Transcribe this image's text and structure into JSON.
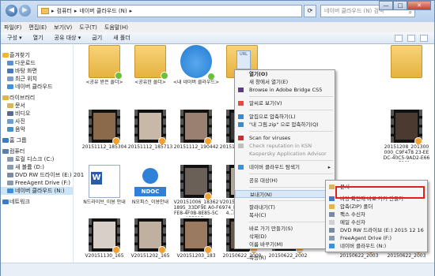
{
  "window": {
    "address_parts": [
      "컴퓨터",
      "네이버 클라우드 (N)"
    ],
    "address_sep": "▸",
    "search_placeholder": "네이버 클라우드 (N) 검색",
    "controls": {
      "min": "—",
      "max": "□",
      "close": "✕"
    }
  },
  "menubar": [
    "파일(F)",
    "편집(E)",
    "보기(V)",
    "도구(T)",
    "도움말(H)"
  ],
  "toolbar": {
    "items": [
      "구성 ▾",
      "열기",
      "공유 대상 ▾",
      "굽기",
      "새 폴더"
    ]
  },
  "sidebar": [
    {
      "label": "즐겨찾기",
      "group": true,
      "icon": "star-icon",
      "color": "#f2b632"
    },
    {
      "label": "다운로드",
      "icon": "download-icon",
      "color": "#5a8fd0"
    },
    {
      "label": "바탕 화면",
      "icon": "desktop-icon",
      "color": "#4a78c0"
    },
    {
      "label": "최근 위치",
      "icon": "recent-icon",
      "color": "#7a9cc6"
    },
    {
      "label": "네이버 클라우드",
      "icon": "cloud-icon",
      "color": "#3d8fe0"
    },
    {
      "label": "라이브러리",
      "group": true,
      "icon": "library-icon",
      "color": "#e2b54a"
    },
    {
      "label": "문서",
      "icon": "document-icon",
      "color": "#d9b45a"
    },
    {
      "label": "비디오",
      "icon": "video-icon",
      "color": "#5a6a8a"
    },
    {
      "label": "사진",
      "icon": "picture-icon",
      "color": "#6aa0d0"
    },
    {
      "label": "음악",
      "icon": "music-icon",
      "color": "#4a90c8"
    },
    {
      "label": "홈 그룹",
      "group": true,
      "icon": "homegroup-icon",
      "color": "#3c7cc6"
    },
    {
      "label": "컴퓨터",
      "group": true,
      "icon": "computer-icon",
      "color": "#5a7fa8"
    },
    {
      "label": "로컬 디스크 (C:)",
      "icon": "disk-icon",
      "color": "#8a9aae"
    },
    {
      "label": "새 볼륨 (D:)",
      "icon": "disk-icon",
      "color": "#8a9aae"
    },
    {
      "label": "DVD RW 드라이브 (E:) 201",
      "icon": "dvd-icon",
      "color": "#7a8aa0"
    },
    {
      "label": "FreeAgent Drive (F:)",
      "icon": "disk-icon",
      "color": "#8a9aae"
    },
    {
      "label": "네이버 클라우드 (N:)",
      "icon": "cloud-icon",
      "color": "#3d8fe0",
      "selected": true
    },
    {
      "label": "네트워크",
      "group": true,
      "icon": "network-icon",
      "color": "#3c7cc6"
    }
  ],
  "files": [
    {
      "name": "<공유 받은 폴더>",
      "kind": "folder",
      "badge": "green"
    },
    {
      "name": "<공유한 폴더>",
      "kind": "folder",
      "badge": "green"
    },
    {
      "name": "<내 네이버 클라우드>",
      "kind": "cloud"
    },
    {
      "name": "내 그림",
      "kind": "folder-url"
    },
    {
      "name": "",
      "kind": "folder"
    },
    {
      "name": "20151112_185304",
      "kind": "video",
      "color": "#8a6a4a"
    },
    {
      "name": "20151112_185713",
      "kind": "video",
      "color": "#c8b8a8"
    },
    {
      "name": "20151112_190442",
      "kind": "video",
      "color": "#9a8070"
    },
    {
      "name": "20151112_190808",
      "kind": "video",
      "color": "#3a3a3a"
    },
    {
      "name": "20151208_201300000_C9F478 23-EEDC-40C5-9AD2-E66F661...",
      "kind": "video",
      "color": "#4a3a30"
    },
    {
      "name": "N드라이브_이용 안내",
      "kind": "word"
    },
    {
      "name": "N오피스_이용안내",
      "kind": "ndoc"
    },
    {
      "name": "V20151006_183621895_33DF9E A0-FFE8-4F0B-8E85-5CA5781F...",
      "kind": "video",
      "color": "#6a6058"
    },
    {
      "name": "V20151018_144046974_FFC...5-1915-4...E-CF39C...",
      "kind": "video",
      "color": "#b0a898"
    },
    {
      "name": "V20151130_165",
      "kind": "video",
      "color": "#d8d0c8"
    },
    {
      "name": "V20151202_165",
      "kind": "video",
      "color": "#c0b0a0"
    },
    {
      "name": "V20151203_183",
      "kind": "video",
      "color": "#9a7a60"
    },
    {
      "name": "20150622_2000",
      "kind": "video",
      "color": "#6a5a4a"
    },
    {
      "name": "20150622_2002",
      "kind": "video",
      "color": "#5a5048"
    },
    {
      "name": "20150622_2003",
      "kind": "video",
      "color": "#8a7868"
    },
    {
      "name": "20150622_2003",
      "kind": "video",
      "color": "#a09080"
    }
  ],
  "context_menu": {
    "items": [
      {
        "label": "열기(O)",
        "bold": true
      },
      {
        "label": "새 창에서 열기(E)"
      },
      {
        "label": "Browse in Adobe Bridge CS5",
        "icon": "bridge-icon",
        "color": "#5a3a8a"
      },
      {
        "sep": true
      },
      {
        "label": "알씨로 보기(V)",
        "icon": "alsee-icon",
        "color": "#e84a3a"
      },
      {
        "sep": true
      },
      {
        "label": "알집으로 압축하기(L)",
        "icon": "alzip-icon",
        "color": "#3a8ad0"
      },
      {
        "label": "\"내 그림.zip\" 으로 압축하기(Q)",
        "icon": "alzip-icon",
        "color": "#3a8ad0"
      },
      {
        "sep": true
      },
      {
        "label": "Scan for viruses",
        "icon": "kaspersky-icon",
        "color": "#c83030"
      },
      {
        "label": "Check reputation in KSN",
        "disabled": true,
        "icon": "kaspersky-icon",
        "color": "#c0c0c0"
      },
      {
        "label": "Kaspersky Application Advisor",
        "disabled": true
      },
      {
        "sep": true
      },
      {
        "label": "네이버 클라우드 탐색기",
        "arrow": true,
        "icon": "naver-cloud-icon",
        "color": "#3d8fe0"
      },
      {
        "sep": true
      },
      {
        "label": "공유 대상(H)",
        "arrow": true
      },
      {
        "sep": true
      },
      {
        "label": "보내기(N)",
        "arrow": true,
        "highlight": true
      },
      {
        "sep": true
      },
      {
        "label": "잘라내기(T)"
      },
      {
        "label": "복사(C)"
      },
      {
        "sep": true
      },
      {
        "label": "바로 가기 만들기(S)"
      },
      {
        "label": "삭제(D)"
      },
      {
        "label": "이름 바꾸기(M)"
      },
      {
        "sep": true
      },
      {
        "label": "속성(R)"
      }
    ]
  },
  "submenu": {
    "items": [
      {
        "label": "문서",
        "icon": "document-icon",
        "color": "#d9b45a"
      },
      {
        "label": "바탕 화면에 바로 가기 만들기",
        "icon": "desktop-icon",
        "color": "#4a78c0"
      },
      {
        "label": "압축(ZIP) 폴더",
        "icon": "zip-folder-icon",
        "color": "#e2b54a"
      },
      {
        "label": "팩스 수신자",
        "icon": "fax-icon",
        "color": "#7a8a9a"
      },
      {
        "label": "메일 수신자",
        "icon": "mail-icon",
        "color": "#d0d0d0"
      },
      {
        "label": "DVD RW 드라이브 (E:) 2015 12 16",
        "icon": "dvd-icon",
        "color": "#7a8aa0"
      },
      {
        "label": "FreeAgent Drive (F:)",
        "icon": "disk-icon",
        "color": "#8a9aae"
      },
      {
        "label": "네이버 클라우드 (N:)",
        "icon": "cloud-icon",
        "color": "#3d8fe0"
      }
    ],
    "highlight_color": "#e0201f"
  }
}
